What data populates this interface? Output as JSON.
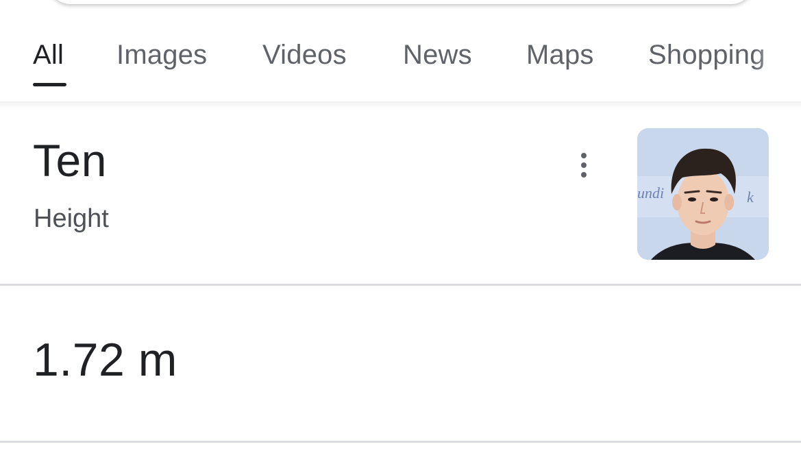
{
  "tabs": [
    {
      "label": "All",
      "active": true
    },
    {
      "label": "Images",
      "active": false
    },
    {
      "label": "Videos",
      "active": false
    },
    {
      "label": "News",
      "active": false
    },
    {
      "label": "Maps",
      "active": false
    },
    {
      "label": "Shopping",
      "active": false
    }
  ],
  "entity": {
    "title": "Ten",
    "subtitle": "Height",
    "more_icon": "more-vert-icon",
    "thumbnail_icon": "person-photo"
  },
  "answer": {
    "value": "1.72 m"
  },
  "colors": {
    "text_primary": "#202124",
    "text_secondary": "#5f6368",
    "divider": "#dadce0",
    "thumb_bg": "#c9d7ec"
  }
}
